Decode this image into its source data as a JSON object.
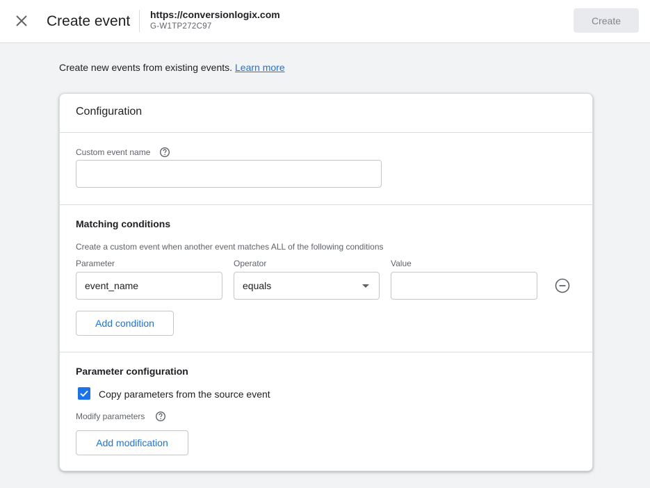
{
  "header": {
    "title": "Create event",
    "site_url": "https://conversionlogix.com",
    "site_id": "G-W1TP272C97",
    "create_label": "Create"
  },
  "intro": {
    "text": "Create new events from existing events.",
    "link": "Learn more"
  },
  "card": {
    "title": "Configuration",
    "custom_event": {
      "label": "Custom event name",
      "value": ""
    },
    "matching": {
      "title": "Matching conditions",
      "description": "Create a custom event when another event matches ALL of the following conditions",
      "parameter_label": "Parameter",
      "operator_label": "Operator",
      "value_label": "Value",
      "parameter_value": "event_name",
      "operator_value": "equals",
      "value_value": "",
      "add_condition_label": "Add condition"
    },
    "param_config": {
      "title": "Parameter configuration",
      "copy_label": "Copy parameters from the source event",
      "copy_checked": true,
      "modify_label": "Modify parameters",
      "add_modification_label": "Add modification"
    }
  },
  "colors": {
    "accent": "#1a73e8",
    "background": "#f1f3f4"
  }
}
